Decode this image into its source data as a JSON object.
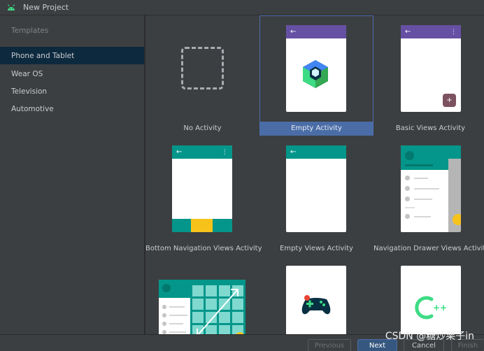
{
  "window": {
    "title": "New Project"
  },
  "sidebar": {
    "section_label": "Templates",
    "items": [
      {
        "label": "Phone and Tablet",
        "selected": true
      },
      {
        "label": "Wear OS",
        "selected": false
      },
      {
        "label": "Television",
        "selected": false
      },
      {
        "label": "Automotive",
        "selected": false
      }
    ]
  },
  "templates": [
    {
      "label": "No Activity"
    },
    {
      "label": "Empty Activity",
      "selected": true
    },
    {
      "label": "Basic Views Activity"
    },
    {
      "label": "Bottom Navigation Views Activity"
    },
    {
      "label": "Empty Views Activity"
    },
    {
      "label": "Navigation Drawer Views Activity"
    }
  ],
  "footer": {
    "previous_label": "Previous",
    "next_label": "Next",
    "cancel_label": "Cancel",
    "finish_label": "Finish",
    "watermark": "CSDN @糖炒栗子in"
  },
  "colors": {
    "purple_bar": "#6650a4",
    "teal_bar": "#04968a",
    "accent_yellow": "#f7c31b",
    "fab": "#7d5260",
    "selection": "#4a6da7"
  },
  "icons": {
    "back": "←",
    "more": "⋮",
    "plus": "+"
  }
}
